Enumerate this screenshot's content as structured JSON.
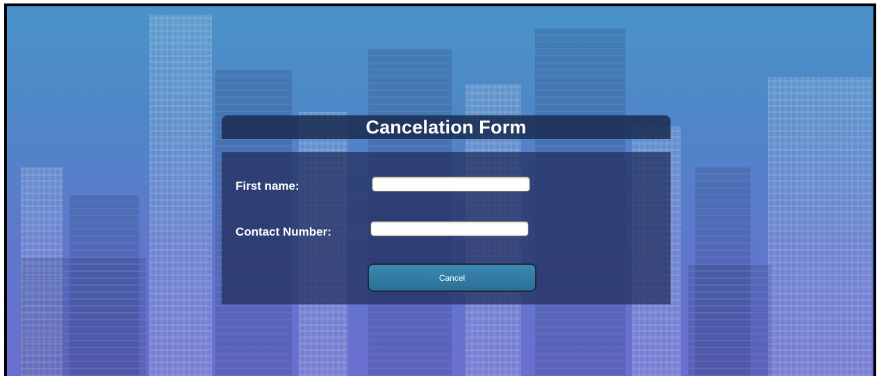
{
  "form": {
    "title": "Cancelation Form",
    "fields": [
      {
        "label": "First name:",
        "value": "",
        "placeholder": ""
      },
      {
        "label": "Contact Number:",
        "value": "",
        "placeholder": ""
      }
    ],
    "cancel_label": "Cancel"
  },
  "colors": {
    "header_bg": "#1a2c50",
    "body_bg": "#212d5a",
    "button_bg": "#2c6f97",
    "background_top": "#4a93c9",
    "background_bottom": "#6b6fd0"
  }
}
